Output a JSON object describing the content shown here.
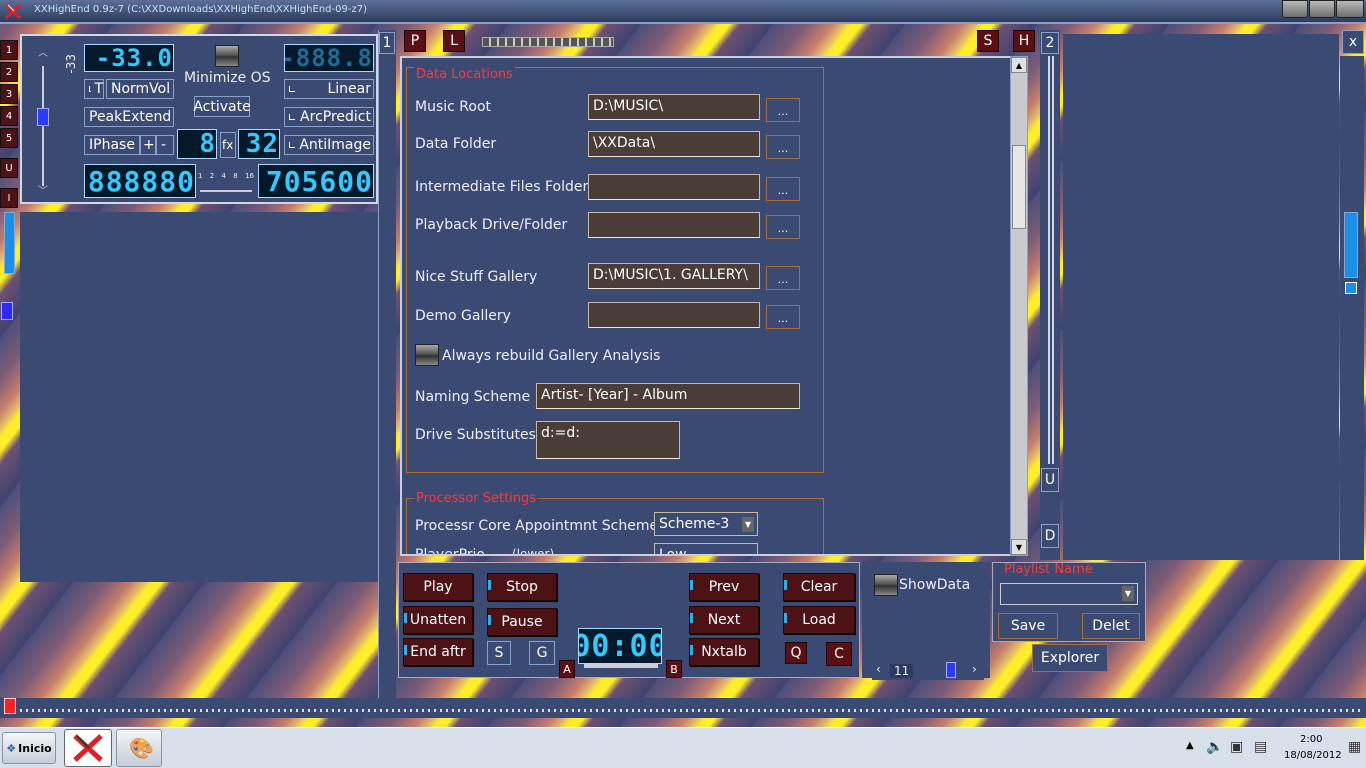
{
  "window": {
    "title": "XXHighEnd 0.9z-7 (C:\\XXDownloads\\XXHighEnd\\XXHighEnd-09-z7)"
  },
  "left_tabs": [
    "1",
    "2",
    "3",
    "4",
    "5",
    "U",
    "I"
  ],
  "volume": {
    "value": "-33",
    "lcd_left": "-33.0",
    "lcd_right": "-888.8",
    "normvol": "NormVol",
    "t_label": "T",
    "peakextend": "PeakExtend",
    "iphase": "IPhase",
    "plus": "+",
    "minus": "-",
    "minimize_os": "Minimize OS",
    "activate": "Activate",
    "linear": "Linear",
    "arcpredict": "ArcPredict",
    "antiimage": "AntiImage",
    "lcd_mid_a": "8",
    "fx": "fx",
    "lcd_mid_b": "32",
    "lcd_counter": "888880",
    "lcd_rate": "705600",
    "scale_marks": [
      "1",
      "2",
      "4",
      "8",
      "16"
    ]
  },
  "toolbar": {
    "p": "P",
    "l": "L",
    "s": "S",
    "h": "H",
    "one": "1",
    "two": "2",
    "x": "x",
    "u": "U",
    "d": "D"
  },
  "settings": {
    "data_locations_title": "Data Locations",
    "rows": [
      {
        "label": "Music Root",
        "value": "D:\\MUSIC\\",
        "browse": "..."
      },
      {
        "label": "Data Folder",
        "value": "\\XXData\\",
        "browse": "..."
      },
      {
        "label": "Intermediate Files Folder",
        "value": "",
        "browse": "..."
      },
      {
        "label": "Playback Drive/Folder",
        "value": "",
        "browse": "..."
      },
      {
        "label": "Nice Stuff Gallery",
        "value": "D:\\MUSIC\\1. GALLERY\\",
        "browse": "..."
      },
      {
        "label": "Demo Gallery",
        "value": "",
        "browse": "..."
      }
    ],
    "always_rebuild": "Always rebuild Gallery Analysis",
    "naming_label": "Naming Scheme",
    "naming_value": "Artist- [Year] - Album",
    "drive_label": "Drive Substitutes",
    "drive_value": "d:=d:",
    "processor_title": "Processor Settings",
    "core_label": "Processr Core Appointmnt Scheme",
    "core_value": "Scheme-3",
    "prio_label": "PlayerPrio",
    "prio_hint": "(lower)",
    "prio_value": "Low"
  },
  "transport": {
    "play": "Play",
    "stop": "Stop",
    "prev": "Prev",
    "clear": "Clear",
    "unatten": "Unatten",
    "pause": "Pause",
    "next": "Next",
    "load": "Load",
    "end_aftr": "End aftr",
    "s": "S",
    "g": "G",
    "time": "00:00",
    "a": "A",
    "b": "B",
    "nxtalb": "Nxtalb",
    "q": "Q",
    "c": "C"
  },
  "playlist": {
    "showdata": "ShowData",
    "title": "Playlist Name",
    "save": "Save",
    "delete": "Delet",
    "explorer": "Explorer",
    "page": "11"
  },
  "taskbar": {
    "start": "Inicio",
    "time": "2:00",
    "date": "18/08/2012"
  }
}
